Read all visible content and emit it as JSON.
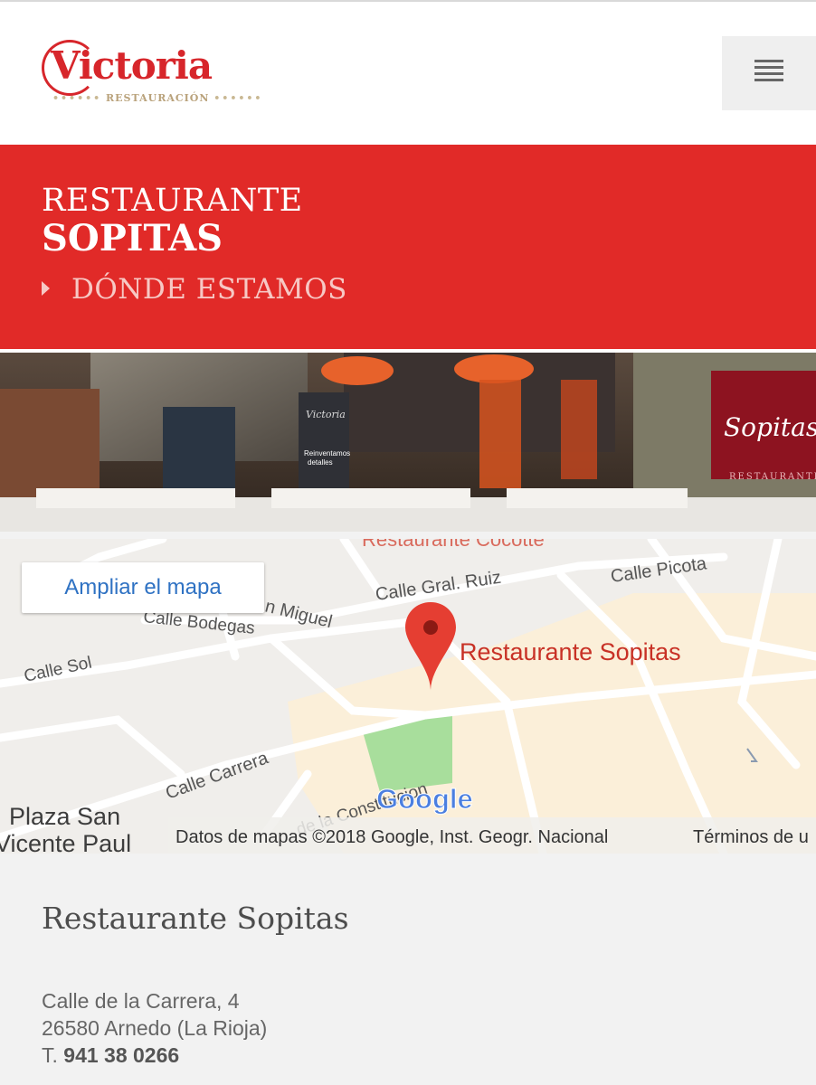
{
  "brand": {
    "name": "Victoria",
    "tagline": "RESTAURACIÓN",
    "color": "#d7262b"
  },
  "header": {
    "menu_icon": "hamburger-menu-icon"
  },
  "banner": {
    "line1": "RESTAURANTE",
    "line2": "SOPITAS",
    "breadcrumb": "DÓNDE ESTAMOS",
    "color": "#e12a28"
  },
  "photo": {
    "sign_text": "Sopitas",
    "sign_sub": "RESTAURANTE",
    "banner_brand": "Victoria",
    "banner_slogan_1": "Reinventamos",
    "banner_slogan_2": "detalles"
  },
  "map": {
    "expand_label": "Ampliar el mapa",
    "marker_label": "Restaurante Sopitas",
    "streets": {
      "gral_ruiz": "Calle Gral. Ruiz",
      "picota": "Calle Picota",
      "bodegas": "Calle Bodegas",
      "san_miguel": "n Miguel",
      "sol": "Calle Sol",
      "carrera": "Calle Carrera",
      "constitucion": "de la Constitucion",
      "plaza1": "Plaza San",
      "plaza2": "Vicente Paul",
      "top_partial": "Restaurante Cocotte"
    },
    "attribution": "Datos de mapas ©2018 Google, Inst. Geogr. Nacional",
    "terms": "Términos de u",
    "google_logo": "Google",
    "pin_icon": "map-pin-icon"
  },
  "info": {
    "name": "Restaurante Sopitas",
    "address_line1": "Calle de la Carrera, 4",
    "address_line2": "26580 Arnedo (La Rioja)",
    "phone_prefix": "T.",
    "phone": "941 38 0266"
  }
}
